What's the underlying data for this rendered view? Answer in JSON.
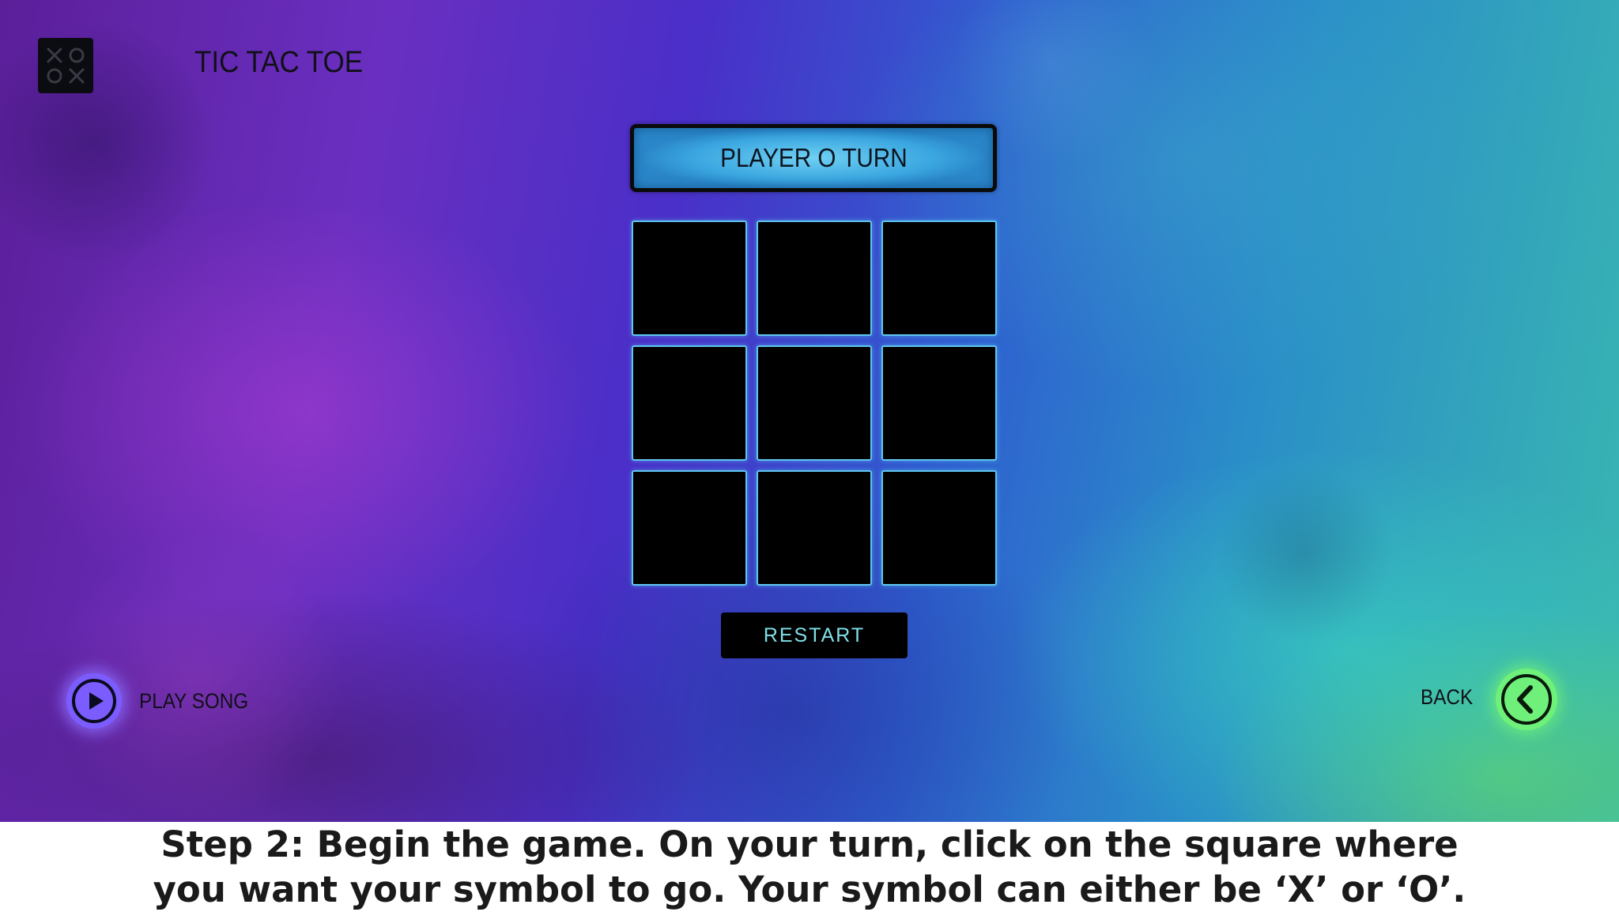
{
  "app": {
    "title": "TIC TAC TOE",
    "logo_icon": "xo-logo-icon"
  },
  "game": {
    "turn_text": "PLAYER O TURN",
    "board": [
      "",
      "",
      "",
      "",
      "",
      "",
      "",
      "",
      ""
    ],
    "restart_label": "RESTART"
  },
  "controls": {
    "play_song_label": "PLAY SONG",
    "play_icon": "play-icon",
    "back_label": "BACK",
    "back_icon": "chevron-left-icon"
  },
  "caption": {
    "line1": "Step 2: Begin the game. On your turn, click on the square where",
    "line2": "you want your symbol to go. Your symbol can either be ‘X’ or ‘O’."
  },
  "colors": {
    "cell_border": "#5ec6f0",
    "banner": "#3aa6e0",
    "play_button": "#7b5cff",
    "back_button": "#6ef07a",
    "restart_text": "#7fe0e8"
  }
}
